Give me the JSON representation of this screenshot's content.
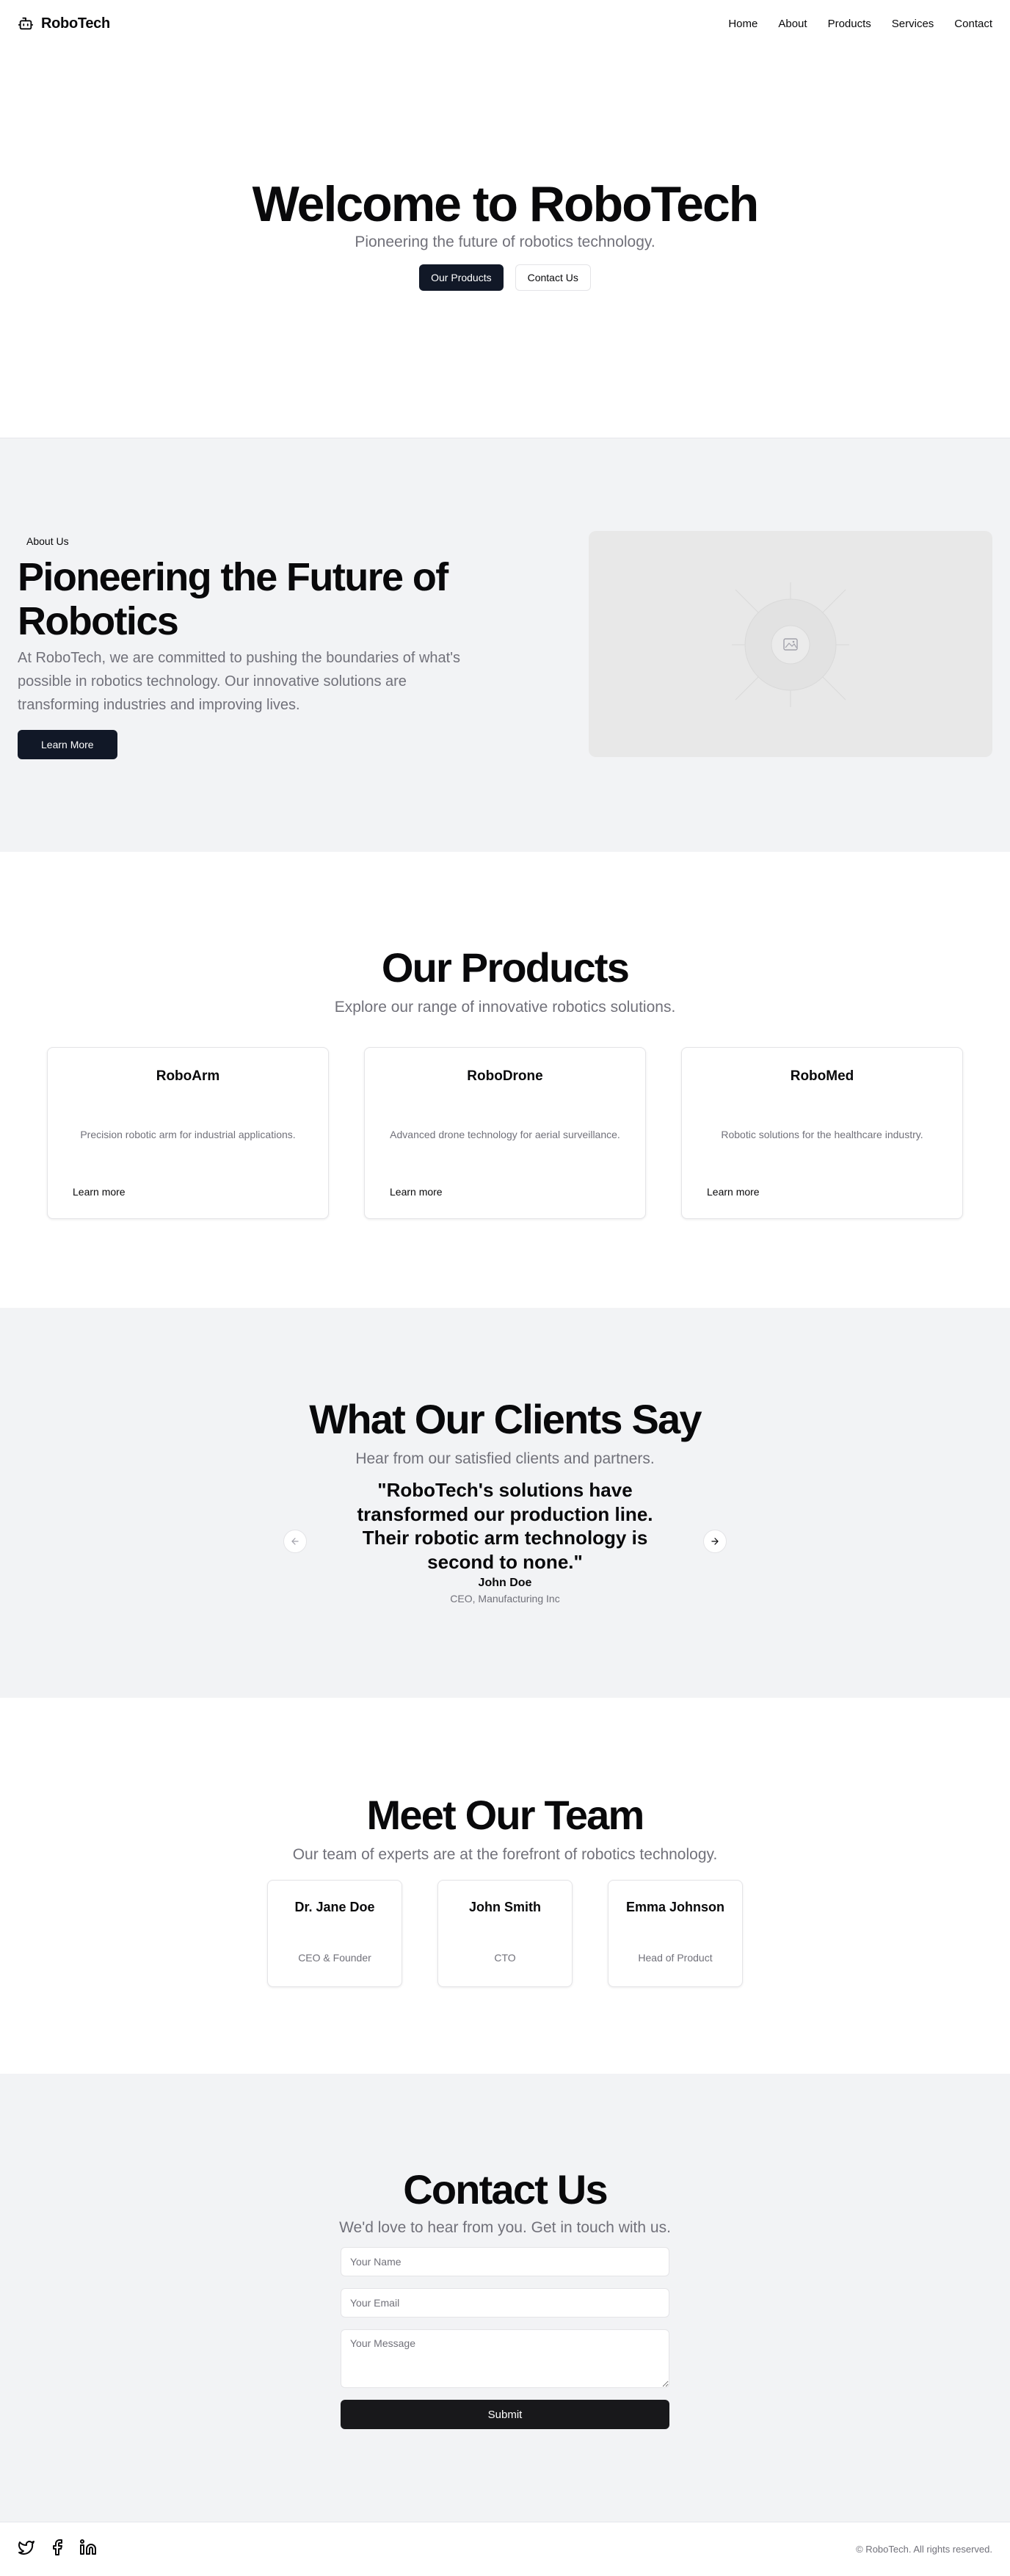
{
  "header": {
    "brand": "RoboTech",
    "logo_icon": "bot-icon",
    "nav": [
      "Home",
      "About",
      "Products",
      "Services",
      "Contact"
    ]
  },
  "hero": {
    "title": "Welcome to RoboTech",
    "subtitle": "Pioneering the future of robotics technology.",
    "primary_button": "Our Products",
    "secondary_button": "Contact Us"
  },
  "about": {
    "tag": "About Us",
    "title": "Pioneering the Future of Robotics",
    "body": "At RoboTech, we are committed to pushing the boundaries of what's possible in robotics technology. Our innovative solutions are transforming industries and improving lives.",
    "button": "Learn More",
    "image_icon": "image-placeholder-icon"
  },
  "products": {
    "title": "Our Products",
    "subtitle": "Explore our range of innovative robotics solutions.",
    "items": [
      {
        "name": "RoboArm",
        "description": "Precision robotic arm for industrial applications.",
        "link": "Learn more"
      },
      {
        "name": "RoboDrone",
        "description": "Advanced drone technology for aerial surveillance.",
        "link": "Learn more"
      },
      {
        "name": "RoboMed",
        "description": "Robotic solutions for the healthcare industry.",
        "link": "Learn more"
      }
    ]
  },
  "testimonials": {
    "title": "What Our Clients Say",
    "subtitle": "Hear from our satisfied clients and partners.",
    "quote": "\"RoboTech's solutions have transformed our production line. Their robotic arm technology is second to none.\"",
    "author": "John Doe",
    "role": "CEO, Manufacturing Inc",
    "prev_icon": "arrow-left-icon",
    "next_icon": "arrow-right-icon"
  },
  "team": {
    "title": "Meet Our Team",
    "subtitle": "Our team of experts are at the forefront of robotics technology.",
    "members": [
      {
        "name": "Dr. Jane Doe",
        "role": "CEO & Founder"
      },
      {
        "name": "John Smith",
        "role": "CTO"
      },
      {
        "name": "Emma Johnson",
        "role": "Head of Product"
      }
    ]
  },
  "contact": {
    "title": "Contact Us",
    "subtitle": "We'd love to hear from you. Get in touch with us.",
    "name_placeholder": "Your Name",
    "email_placeholder": "Your Email",
    "message_placeholder": "Your Message",
    "submit": "Submit"
  },
  "footer": {
    "social_icons": [
      "twitter-icon",
      "facebook-icon",
      "linkedin-icon"
    ],
    "copyright": "© RoboTech. All rights reserved."
  }
}
